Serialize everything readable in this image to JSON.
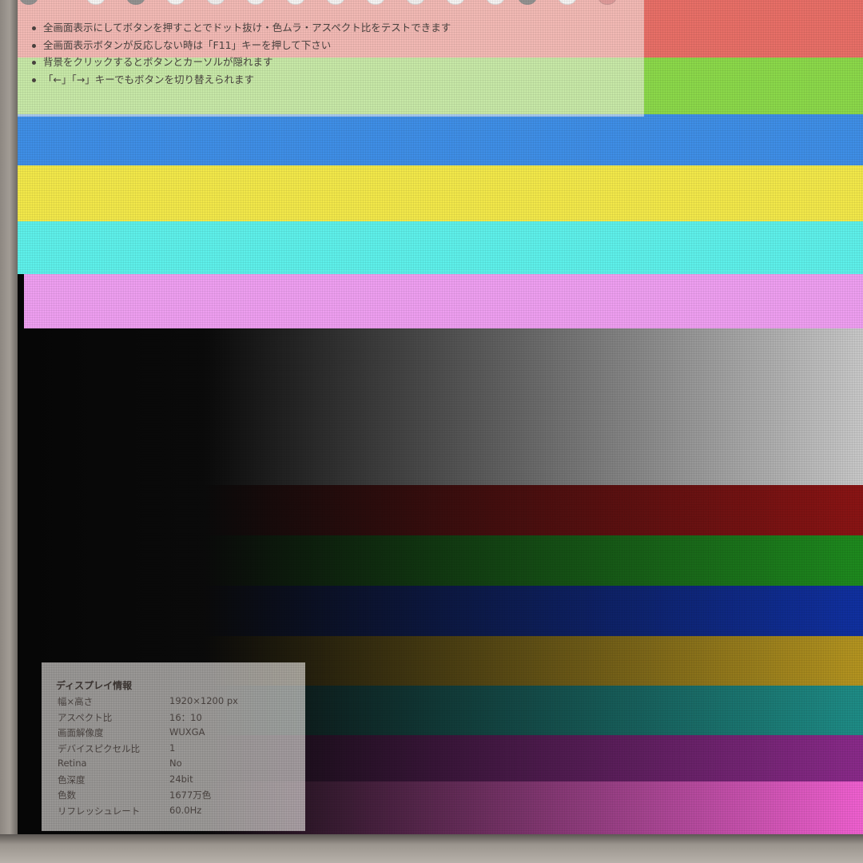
{
  "instructions": [
    "全画面表示にしてボタンを押すことでドット抜け・色ムラ・アスペクト比をテストできます",
    "全画面表示ボタンが反応しない時は「F11」キーを押して下さい",
    "背景をクリックするとボタンとカーソルが隠れます",
    "「←」「→」キーでもボタンを切り替えられます"
  ],
  "swatch_colors": [
    "#1a1a1a",
    "#f4f4f4",
    "#1a1a1a",
    "#f4f4f4",
    "#e6e6e6",
    "#f0f0f0",
    "#f4f4f4",
    "#f0f0f0",
    "#f4f4f4",
    "#e8e8e8",
    "#f4f4f4",
    "#f2f2f2",
    "#1a1a1a",
    "#f4f4f4",
    "#c03030"
  ],
  "solid_bands": [
    "#e86f67",
    "#8bd84a",
    "#3f8ee6",
    "#f2e84a",
    "#5ef0ea",
    "#ee9ef0"
  ],
  "gradient_bands": [
    {
      "name": "white",
      "color": "#c8c8c8"
    },
    {
      "name": "red",
      "color": "#8a1414"
    },
    {
      "name": "green",
      "color": "#1e8a1e"
    },
    {
      "name": "blue",
      "color": "#1030a0"
    },
    {
      "name": "yellow",
      "color": "#b49420"
    },
    {
      "name": "cyan",
      "color": "#1e8c86"
    },
    {
      "name": "magenta",
      "color": "#8a2a8a"
    },
    {
      "name": "pink",
      "color": "#f060d0"
    }
  ],
  "display_info": {
    "title": "ディスプレイ情報",
    "rows": [
      {
        "label": "幅×高さ",
        "value": "1920×1200 px"
      },
      {
        "label": "アスペクト比",
        "value": "16：10"
      },
      {
        "label": "画面解像度",
        "value": "WUXGA"
      },
      {
        "label": "デバイスピクセル比",
        "value": "1"
      },
      {
        "label": "Retina",
        "value": "No"
      },
      {
        "label": "色深度",
        "value": "24bit"
      },
      {
        "label": "色数",
        "value": "1677万色"
      },
      {
        "label": "リフレッシュレート",
        "value": "60.0Hz"
      }
    ]
  }
}
